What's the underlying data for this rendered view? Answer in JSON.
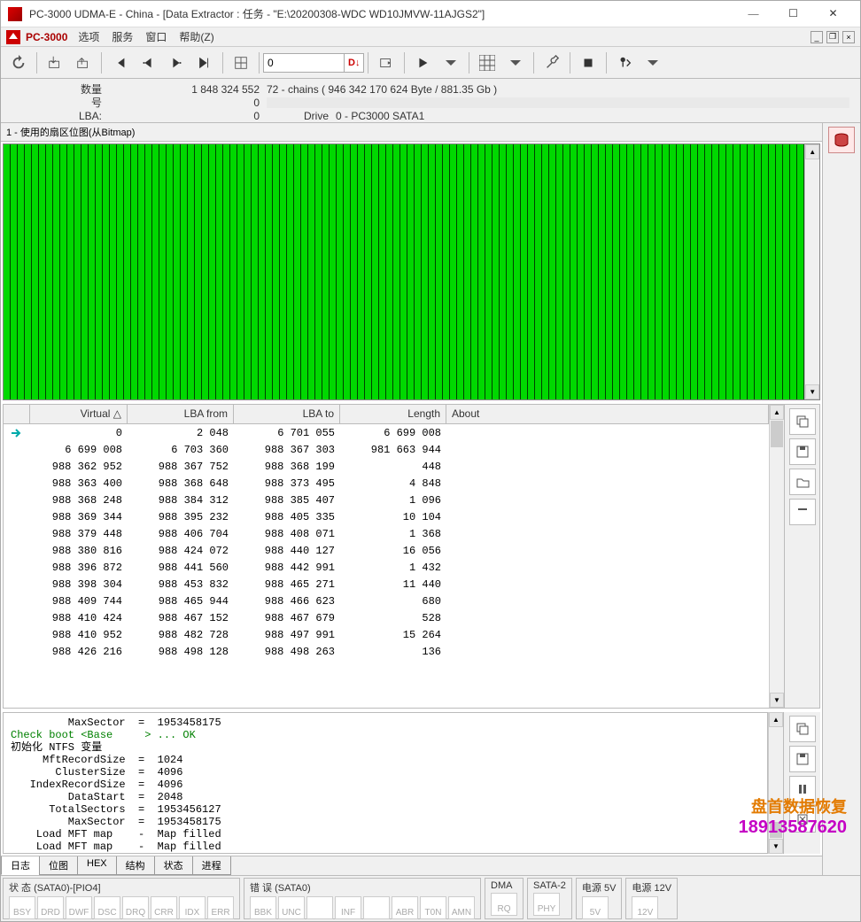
{
  "window": {
    "title": "PC-3000 UDMA-E - China - [Data Extractor : 任务 - \"E:\\20200308-WDC WD10JMVW-11AJGS2\"]",
    "min": "—",
    "max": "☐",
    "close": "✕"
  },
  "menubar": {
    "app": "PC-3000",
    "items": [
      "选项",
      "服务",
      "窗口",
      "帮助(Z)"
    ]
  },
  "toolbar": {
    "input_value": "0",
    "label_d": "D↓"
  },
  "info": {
    "qty_label": "数量",
    "qty_value": "1 848 324 552",
    "qty_extra": "72 - chains  ( 946 342 170 624 Byte / 881.35 Gb )",
    "num_label": "号",
    "num_value": "0",
    "lba_label": "LBA:",
    "lba_value": "0",
    "drive_label": "Drive",
    "drive_value": "0 - PC3000 SATA1"
  },
  "bitmap_label": "1 - 使用的扇区位图(从Bitmap)",
  "table": {
    "headers": [
      "Virtual  △",
      "LBA from",
      "LBA to",
      "Length",
      "About"
    ],
    "widths": [
      120,
      120,
      120,
      120,
      350
    ],
    "rows": [
      [
        "0",
        "2 048",
        "6 701 055",
        "6 699 008",
        ""
      ],
      [
        "6 699 008",
        "6 703 360",
        "988 367 303",
        "981 663 944",
        ""
      ],
      [
        "988 362 952",
        "988 367 752",
        "988 368 199",
        "448",
        ""
      ],
      [
        "988 363 400",
        "988 368 648",
        "988 373 495",
        "4 848",
        ""
      ],
      [
        "988 368 248",
        "988 384 312",
        "988 385 407",
        "1 096",
        ""
      ],
      [
        "988 369 344",
        "988 395 232",
        "988 405 335",
        "10 104",
        ""
      ],
      [
        "988 379 448",
        "988 406 704",
        "988 408 071",
        "1 368",
        ""
      ],
      [
        "988 380 816",
        "988 424 072",
        "988 440 127",
        "16 056",
        ""
      ],
      [
        "988 396 872",
        "988 441 560",
        "988 442 991",
        "1 432",
        ""
      ],
      [
        "988 398 304",
        "988 453 832",
        "988 465 271",
        "11 440",
        ""
      ],
      [
        "988 409 744",
        "988 465 944",
        "988 466 623",
        "680",
        ""
      ],
      [
        "988 410 424",
        "988 467 152",
        "988 467 679",
        "528",
        ""
      ],
      [
        "988 410 952",
        "988 482 728",
        "988 497 991",
        "15 264",
        ""
      ],
      [
        "988 426 216",
        "988 498 128",
        "988 498 263",
        "136",
        ""
      ]
    ]
  },
  "log": {
    "lines": [
      {
        "t": "         MaxSector  =  1953458175",
        "c": "black"
      },
      {
        "t": "Check boot <Base     > ... OK",
        "c": "green"
      },
      {
        "t": "初始化 NTFS 变量",
        "c": "black"
      },
      {
        "t": "     MftRecordSize  =  1024",
        "c": "black"
      },
      {
        "t": "       ClusterSize  =  4096",
        "c": "black"
      },
      {
        "t": "   IndexRecordSize  =  4096",
        "c": "black"
      },
      {
        "t": "         DataStart  =  2048",
        "c": "black"
      },
      {
        "t": "      TotalSectors  =  1953456127",
        "c": "black"
      },
      {
        "t": "         MaxSector  =  1953458175",
        "c": "black"
      },
      {
        "t": "    Load MFT map    -  Map filled",
        "c": "black"
      },
      {
        "t": "    Load MFT map    -  Map filled",
        "c": "black"
      }
    ],
    "tabs": [
      "日志",
      "位图",
      "HEX",
      "结构",
      "状态",
      "进程"
    ]
  },
  "status": {
    "groups": [
      {
        "label": "状 态 (SATA0)-[PIO4]",
        "boxes": [
          "BSY",
          "DRD",
          "DWF",
          "DSC",
          "DRQ",
          "CRR",
          "IDX",
          "ERR"
        ]
      },
      {
        "label": "错 误 (SATA0)",
        "boxes": [
          "BBK",
          "UNC",
          "",
          "INF",
          "",
          "ABR",
          "T0N",
          "AMN"
        ]
      },
      {
        "label": "DMA",
        "boxes": [
          "RQ"
        ]
      },
      {
        "label": "SATA-2",
        "boxes": [
          "PHY"
        ]
      },
      {
        "label": "电源 5V",
        "boxes": [
          "5V"
        ]
      },
      {
        "label": "电源 12V",
        "boxes": [
          "12V"
        ]
      }
    ]
  },
  "watermark": {
    "l1": "盘首数据恢复",
    "l2": "18913587620"
  }
}
